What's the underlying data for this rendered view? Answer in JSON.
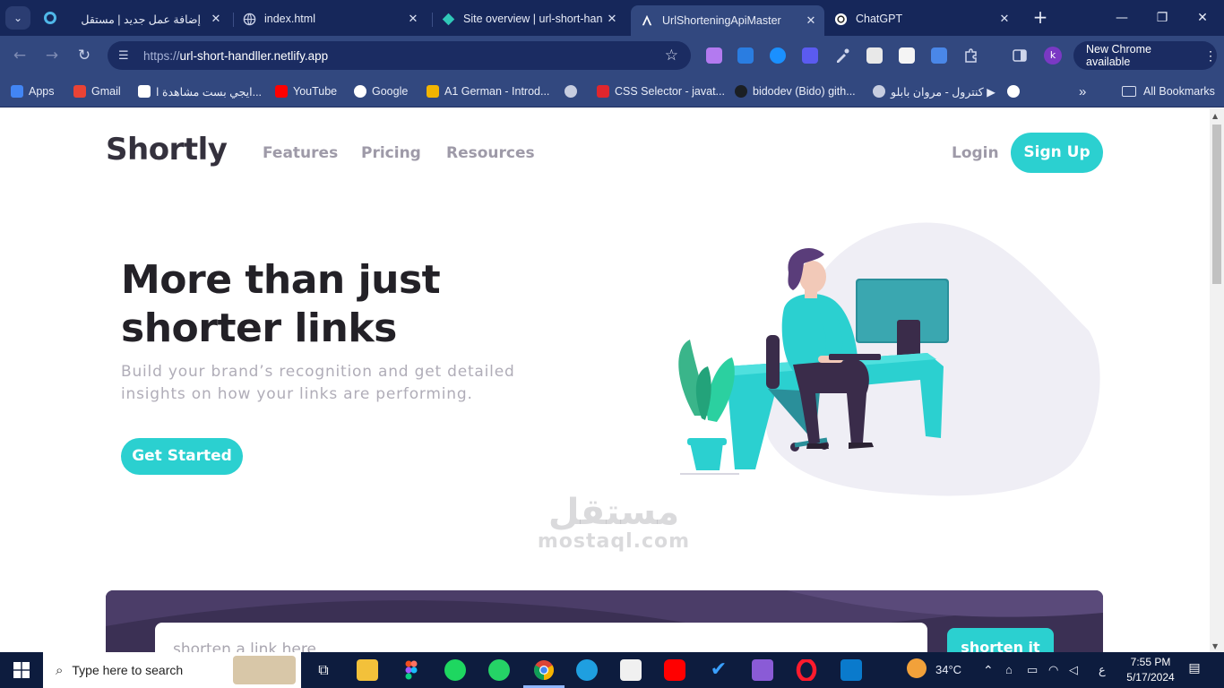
{
  "browser": {
    "tabs": [
      {
        "title": "إضافة عمل جديد | مستقل",
        "active": false
      },
      {
        "title": "index.html",
        "active": false
      },
      {
        "title": "Site overview | url-short-han",
        "active": false
      },
      {
        "title": "UrlShorteningApiMaster",
        "active": true
      },
      {
        "title": "ChatGPT",
        "active": false
      }
    ],
    "close_glyph": "✕",
    "new_tab_glyph": "+",
    "window_controls": {
      "minimize": "—",
      "restore": "❐",
      "close": "✕"
    },
    "address": {
      "scheme": "https://",
      "host": "url-short-handller.netlify.app"
    },
    "new_chrome_label": "New Chrome available",
    "profile_initial": "k",
    "bookmarks": [
      {
        "label": "Apps",
        "color": "#4285f4"
      },
      {
        "label": "Gmail",
        "color": "#ea4335"
      },
      {
        "label": "ايجي بست مشاهدة ا...",
        "color": "#ffffff"
      },
      {
        "label": "YouTube",
        "color": "#ff0000"
      },
      {
        "label": "Google",
        "color": "#ffffff"
      },
      {
        "label": "A1 German - Introd...",
        "color": "#f2b400"
      },
      {
        "label": "",
        "color": "#c7cde0"
      },
      {
        "label": "CSS Selector - javat...",
        "color": "#e0262d"
      },
      {
        "label": "bidodev (Bido) gith...",
        "color": "#1b1f24"
      },
      {
        "label": "كنترول - مروان بابلو ▶",
        "color": "#c7cde0"
      },
      {
        "label": "",
        "color": "#ffffff"
      }
    ],
    "all_bookmarks_label": "All Bookmarks"
  },
  "site": {
    "logo": "Shortly",
    "nav": [
      "Features",
      "Pricing",
      "Resources"
    ],
    "login": "Login",
    "signup": "Sign Up",
    "hero_title": "More than just shorter links",
    "hero_subtitle": "Build your brand’s recognition and get detailed insights on how your links are performing.",
    "cta": "Get Started",
    "shorten_placeholder": "shorten a link here",
    "shorten_button": "shorten it",
    "colors": {
      "cyan": "#2bd0d0",
      "dark_violet": "#3b3054",
      "gray": "#9e9aa8",
      "dark_text": "#232127"
    }
  },
  "watermark": {
    "arabic": "مستقل",
    "latin": "mostaql.com"
  },
  "taskbar": {
    "search_placeholder": "Type here to search",
    "weather": "34°C",
    "language": "ع",
    "time": "7:55 PM",
    "date": "5/17/2024"
  }
}
